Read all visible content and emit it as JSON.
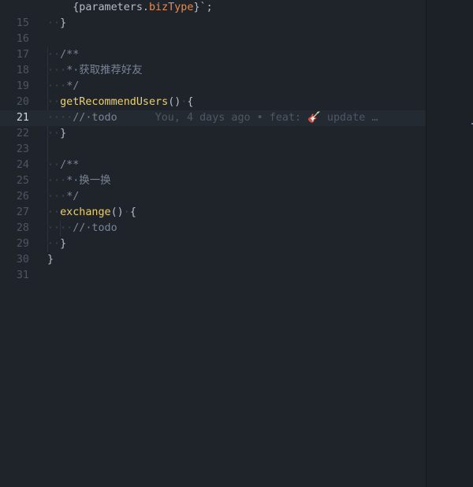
{
  "editor": {
    "lines": [
      {
        "num": "",
        "segments": [
          {
            "t": "    ",
            "c": "ws"
          },
          {
            "t": "{parameters.",
            "c": "pn"
          },
          {
            "t": "bizType",
            "c": "prop"
          },
          {
            "t": "}`",
            "c": "pn"
          },
          {
            "t": ";",
            "c": "pn"
          }
        ]
      },
      {
        "num": "15",
        "segments": [
          {
            "t": "··",
            "c": "ws"
          },
          {
            "t": "}",
            "c": "pn"
          }
        ]
      },
      {
        "num": "16",
        "segments": []
      },
      {
        "num": "17",
        "segments": [
          {
            "t": "··",
            "c": "ws"
          },
          {
            "t": "/**",
            "c": "cm"
          }
        ]
      },
      {
        "num": "18",
        "segments": [
          {
            "t": "···",
            "c": "ws"
          },
          {
            "t": "*·获取推荐好友",
            "c": "cm"
          }
        ]
      },
      {
        "num": "19",
        "segments": [
          {
            "t": "···",
            "c": "ws"
          },
          {
            "t": "*/",
            "c": "cm"
          }
        ]
      },
      {
        "num": "20",
        "segments": [
          {
            "t": "··",
            "c": "ws"
          },
          {
            "t": "getRecommendUsers",
            "c": "fn"
          },
          {
            "t": "()",
            "c": "pn"
          },
          {
            "t": "·",
            "c": "ws"
          },
          {
            "t": "{",
            "c": "pn"
          }
        ]
      },
      {
        "num": "21",
        "current": true,
        "segments": [
          {
            "t": "····",
            "c": "ws"
          },
          {
            "t": "//·todo",
            "c": "cm"
          }
        ],
        "blame": "You, 4 days ago • feat: 🎸 update …"
      },
      {
        "num": "22",
        "segments": [
          {
            "t": "··",
            "c": "ws"
          },
          {
            "t": "}",
            "c": "pn"
          }
        ]
      },
      {
        "num": "23",
        "segments": []
      },
      {
        "num": "24",
        "segments": [
          {
            "t": "··",
            "c": "ws"
          },
          {
            "t": "/**",
            "c": "cm"
          }
        ]
      },
      {
        "num": "25",
        "segments": [
          {
            "t": "···",
            "c": "ws"
          },
          {
            "t": "*·换一换",
            "c": "cm"
          }
        ]
      },
      {
        "num": "26",
        "segments": [
          {
            "t": "···",
            "c": "ws"
          },
          {
            "t": "*/",
            "c": "cm"
          }
        ]
      },
      {
        "num": "27",
        "segments": [
          {
            "t": "··",
            "c": "ws"
          },
          {
            "t": "exchange",
            "c": "fn"
          },
          {
            "t": "()",
            "c": "pn"
          },
          {
            "t": "·",
            "c": "ws"
          },
          {
            "t": "{",
            "c": "pn"
          }
        ]
      },
      {
        "num": "28",
        "segments": [
          {
            "t": "····",
            "c": "ws"
          },
          {
            "t": "//·todo",
            "c": "cm"
          }
        ]
      },
      {
        "num": "29",
        "segments": [
          {
            "t": "··",
            "c": "ws"
          },
          {
            "t": "}",
            "c": "pn"
          }
        ]
      },
      {
        "num": "30",
        "segments": [
          {
            "t": "}",
            "c": "pn"
          }
        ]
      },
      {
        "num": "31",
        "segments": []
      }
    ]
  },
  "colors": {
    "background": "#1f242b",
    "current_line": "#242a32",
    "function": "#e8d07a",
    "property": "#e88a4e",
    "comment": "#7b8494"
  }
}
